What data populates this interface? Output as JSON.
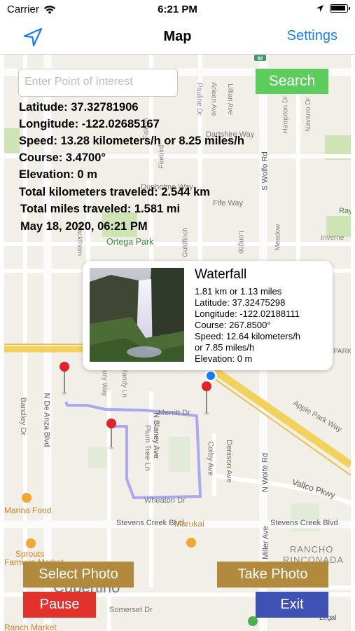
{
  "status_bar": {
    "carrier": "Carrier",
    "time": "6:21 PM"
  },
  "nav": {
    "title": "Map",
    "settings_label": "Settings",
    "location_icon": "location-arrow-icon"
  },
  "search": {
    "placeholder": "Enter Point of Interest",
    "button_label": "Search"
  },
  "tracking": {
    "latitude": "Latitude: 37.32781906",
    "longitude": "Longitude: -122.02685167",
    "speed": "Speed: 13.28 kilometers/h or 8.25 miles/h",
    "course": "Course: 3.4700°",
    "elevation": "Elevation: 0 m",
    "total_km": "Total kilometers traveled: 2.544 km",
    "total_mi": "Total miles traveled: 1.581 mi",
    "datetime": "May 18, 2020, 06:21 PM"
  },
  "callout": {
    "title": "Waterfall",
    "distance": "1.81 km or 1.13 miles",
    "latitude": "Latitude: 37.32475298",
    "longitude": "Longitude: -122.02188111",
    "course": "Course: 267.8500°",
    "speed_line1": "Speed: 12.64 kilometers/h",
    "speed_line2": "or 7.85 miles/h",
    "elevation": "Elevation: 0 m"
  },
  "buttons": {
    "select_photo": "Select Photo",
    "take_photo": "Take Photo",
    "pause": "Pause",
    "exit": "Exit"
  },
  "map_labels": {
    "ortega_park": "Ortega Park",
    "dartshire_way": "Dartshire Way",
    "dunholme_way": "Dunholme Way",
    "fife_way": "Fife Way",
    "s_wolfe_rd": "S Wolfe Rd",
    "n_wolfe_rd": "N Wolfe Rd",
    "merritt_dr": "Merritt Dr",
    "wheaton_dr": "Wheaton Dr",
    "stevens_creek_blvd": "Stevens Creek Blvd",
    "vallco_pkwy": "Vallco Pkwy",
    "apple_park_way": "Apple Park Way",
    "n_de_anza_blvd": "N De Anza Blvd",
    "n_blaney_ave": "N Blaney Ave",
    "plum_tree_ln": "Plum Tree Ln",
    "colby_ave": "Colby Ave",
    "denison_ave": "Denison Ave",
    "miller_ave": "Miller Ave",
    "bandley_dr": "Bandley Dr",
    "marina_food": "Marina Food",
    "marukai": "Marukai",
    "sprouts": "Sprouts",
    "farmers_market": "Farmers Market",
    "rancho": "RANCHO",
    "rinconada": "RINCONADA",
    "cupertino": "Cupertino",
    "somerset_dr": "Somerset Dr",
    "ranch_market": "Ranch Market",
    "legal": "Legal",
    "park": "PARK",
    "highway": "82",
    "pauline_dr": "Pauline Dr",
    "arleen_ave": "Arleen Ave",
    "lillian_ave": "Lillian Ave",
    "hampton_dr": "Hampton Dr",
    "navarro_dr": "Navarro Dr",
    "falcon": "Falcon",
    "firebird": "Firebird",
    "goldfinch": "Goldfinch",
    "blackthorn": "Blackthorn",
    "randy_ln": "Randy Ln",
    "larry_way": "arry Way",
    "meadow": "Meadow",
    "longspur": "Longsp",
    "inverne": "Inverne",
    "ray": "Ray"
  },
  "colors": {
    "accent": "#1a7af8",
    "search_green": "#5ccd5c",
    "photo_btn": "#b18a3e",
    "pause_btn": "#e2322c",
    "exit_btn": "#3f51b5",
    "pin": "#e0232b",
    "route": "#a9a8f0",
    "highway": "#f2d25c"
  }
}
